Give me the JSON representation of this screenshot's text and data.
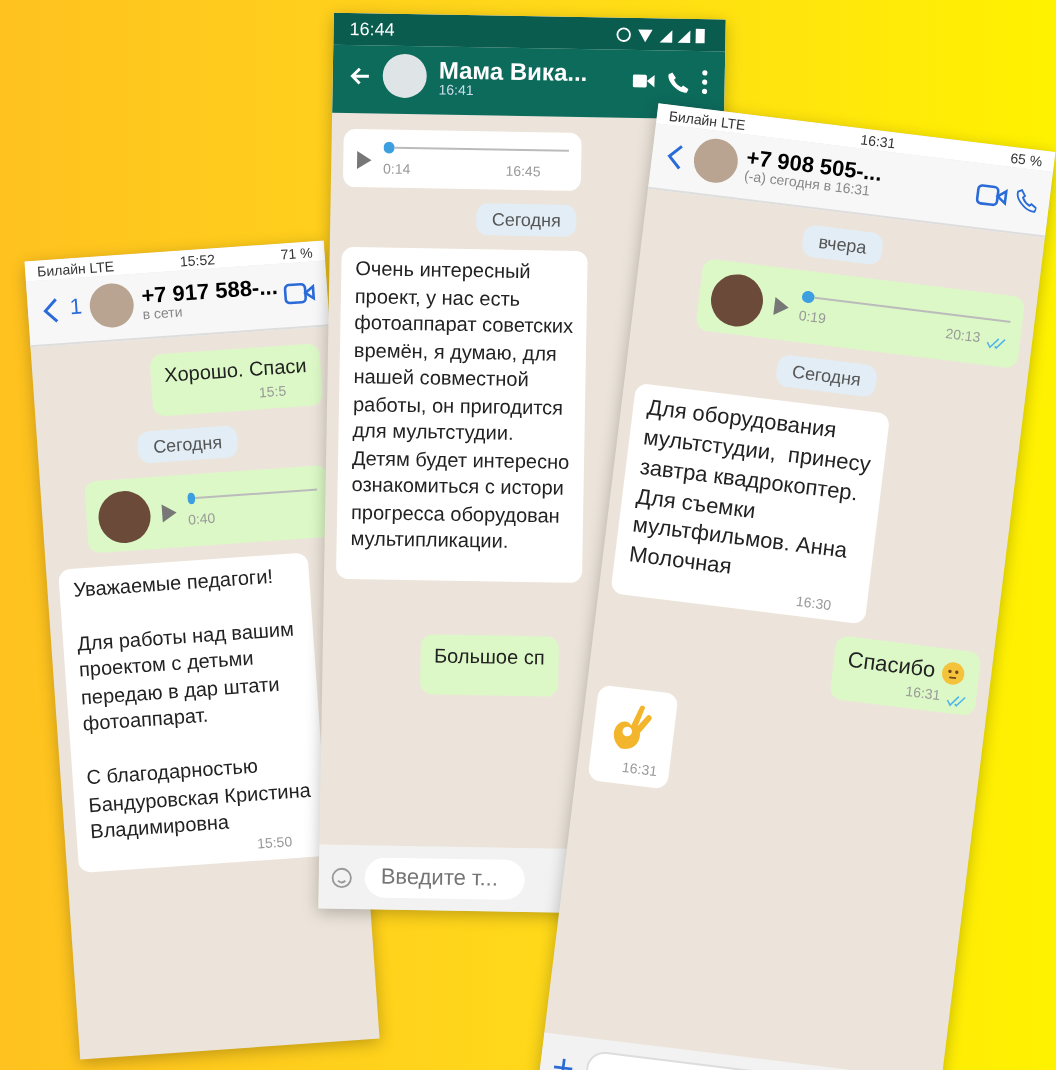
{
  "phones": [
    {
      "kind": "ios",
      "status": {
        "carrier": "Билайн LTE",
        "time": "15:52",
        "battery": "71 %"
      },
      "header": {
        "back": "1",
        "name": "+7 917 588-...",
        "subtitle": "в сети"
      },
      "composer": false,
      "messages": [
        {
          "kind": "outgoing",
          "text": "Хорошо. Спаси",
          "time": "15:5"
        },
        {
          "kind": "date",
          "text": "Сегодня"
        },
        {
          "kind": "voice_out",
          "duration": "0:40"
        },
        {
          "kind": "incoming",
          "text": "Уважаемые педагоги!\n\nДля работы над вашим\nпроектом с детьми\nпередаю в дар штати\nфотоаппарат.\n\nС благодарностью\nБандуровская Кристина\nВладимировна",
          "time": "15:50"
        }
      ]
    },
    {
      "kind": "android",
      "status": {
        "time": "16:44"
      },
      "header": {
        "name": "Мама Вика...",
        "subtitle": "16:41"
      },
      "messages": [
        {
          "kind": "voice_in",
          "duration": "0:14",
          "time": "16:45"
        },
        {
          "kind": "date",
          "text": "Сегодня"
        },
        {
          "kind": "incoming",
          "text": "Очень интересный\nпроект, у нас есть\nфотоаппарат советских\nвремён, я думаю, для\nнашей совместной\nработы, он пригодится\nдля мультстудии.\nДетям будет интересно\nознакомиться с истори\nпрогресса оборудован\nмультипликации."
        },
        {
          "kind": "outgoing",
          "text": "Большое сп"
        }
      ],
      "input": {
        "placeholder": "Введите т..."
      }
    },
    {
      "kind": "ios",
      "status": {
        "carrier": "Билайн LTE",
        "time": "16:31",
        "battery": "65 %"
      },
      "header": {
        "name": "+7 908 505-...",
        "subtitle": "(-а) сегодня в 16:31"
      },
      "composer": true,
      "messages": [
        {
          "kind": "date",
          "text": "вчера"
        },
        {
          "kind": "voice_out",
          "duration": "0:19",
          "time": "20:13",
          "read": true
        },
        {
          "kind": "date",
          "text": "Сегодня"
        },
        {
          "kind": "incoming",
          "text": "Для оборудования\nмультстудии,  принесу\nзавтра квадрокоптер.\nДля съемки\nмультфильмов. Анна\nМолочная",
          "time": "16:30"
        },
        {
          "kind": "outgoing",
          "text": "Спасибо",
          "emoji": true,
          "time": "16:31",
          "read": true
        },
        {
          "kind": "sticker",
          "time": "16:31"
        }
      ]
    }
  ]
}
